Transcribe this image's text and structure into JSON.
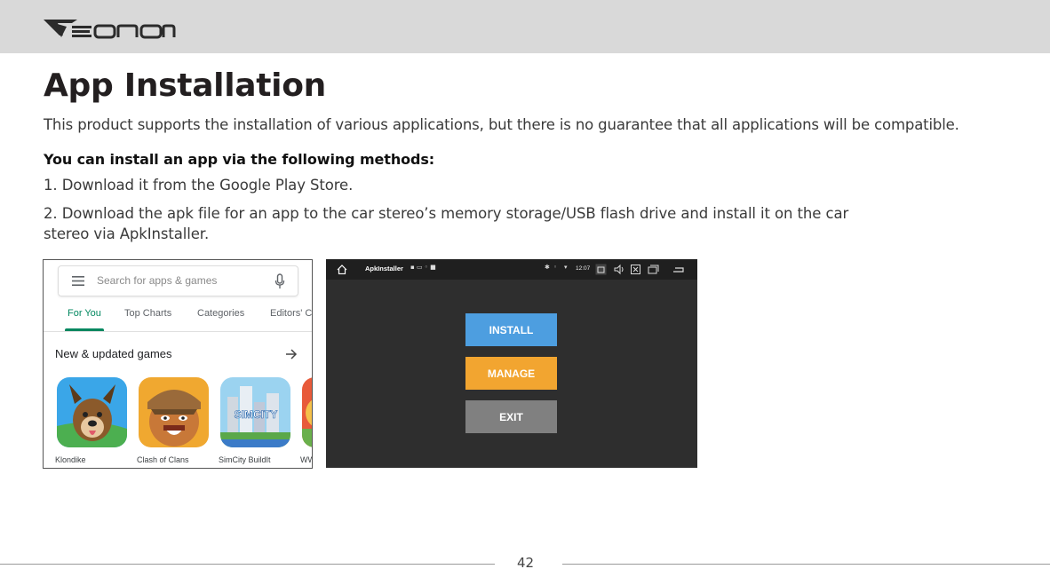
{
  "header": {
    "brand": "EONON"
  },
  "content": {
    "title": "App Installation",
    "intro": "This product supports the installation of various applications, but there is no guarantee that all applications will be compatible.",
    "methods_heading": "You can install an app via the following methods:",
    "step_1": "1. Download it from the Google Play Store.",
    "step_2_line_1": "2. Download the apk file for an app to the car stereo’s memory storage/USB flash drive and install it on the car",
    "step_2_line_2": "stereo via ApkInstaller."
  },
  "play_store": {
    "search_placeholder": "Search for apps & games",
    "tabs": [
      "For You",
      "Top Charts",
      "Categories",
      "Editors' C"
    ],
    "active_tab": "For You",
    "section_heading": "New & updated games",
    "games": [
      "Klondike",
      "Clash of Clans",
      "SimCity BuildIt",
      "WW"
    ],
    "simcity_logo_text": "SIMCITY",
    "accent_color": "#01875f"
  },
  "apk_installer": {
    "app_title": "ApkInstaller",
    "status_time": "12:07",
    "buttons": {
      "install": "INSTALL",
      "manage": "MANAGE",
      "exit": "EXIT"
    },
    "colors": {
      "install": "#4d9ee0",
      "manage": "#f2a530",
      "exit": "#808080",
      "background": "#2e2e2e"
    }
  },
  "footer": {
    "page_number": "42"
  }
}
